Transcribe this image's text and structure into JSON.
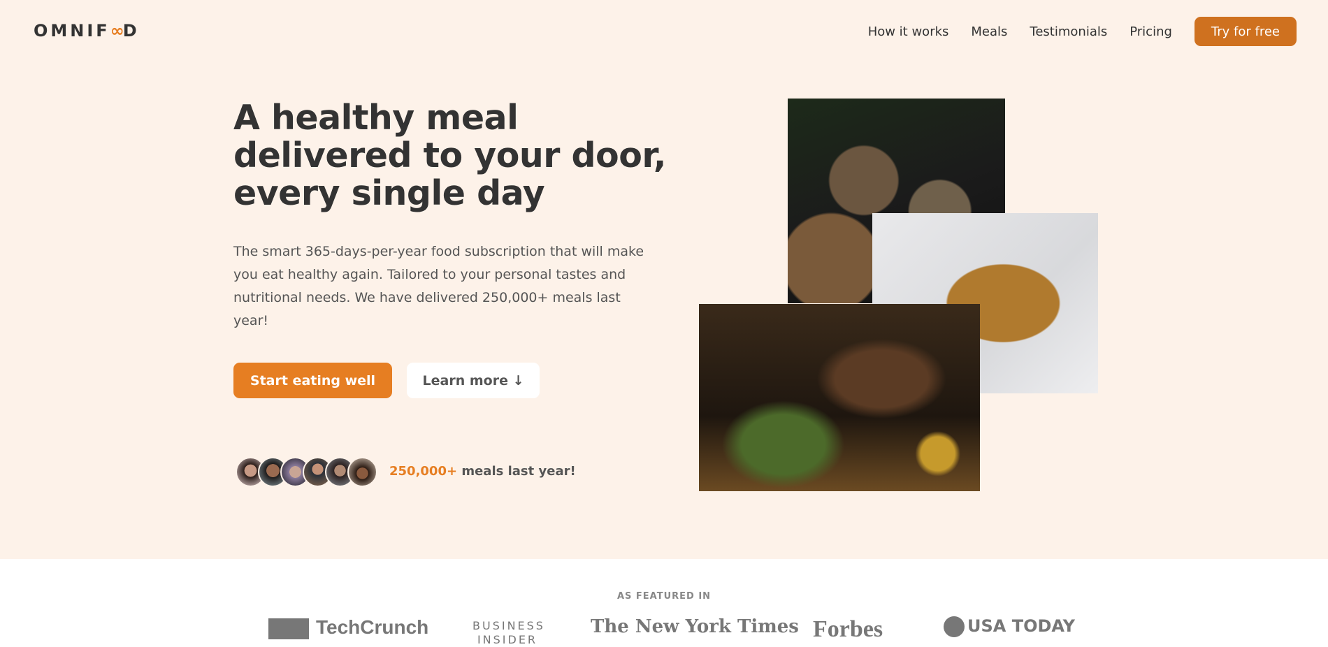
{
  "header": {
    "logo": "OMNIFOOD",
    "nav": [
      "How it works",
      "Meals",
      "Testimonials",
      "Pricing"
    ],
    "cta": "Try for free"
  },
  "hero": {
    "title": "A healthy meal delivered to your door, every single day",
    "description": "The smart 365-days-per-year food subscription that will make you eat healthy again. Tailored to your personal tastes and nutritional needs. We have delivered 250,000+ meals last year!",
    "primary_button": "Start eating well",
    "secondary_button": "Learn more ↓",
    "delivered_highlight": "250,000+",
    "delivered_text": " meals last year!"
  },
  "featured": {
    "label": "AS FEATURED IN",
    "logos": [
      "TechCrunch",
      "BUSINESS INSIDER",
      "The New York Times",
      "Forbes",
      "USA TODAY"
    ]
  },
  "colors": {
    "accent": "#e67e22",
    "hero_bg": "#fdf2e9",
    "cta": "#cf711f"
  }
}
